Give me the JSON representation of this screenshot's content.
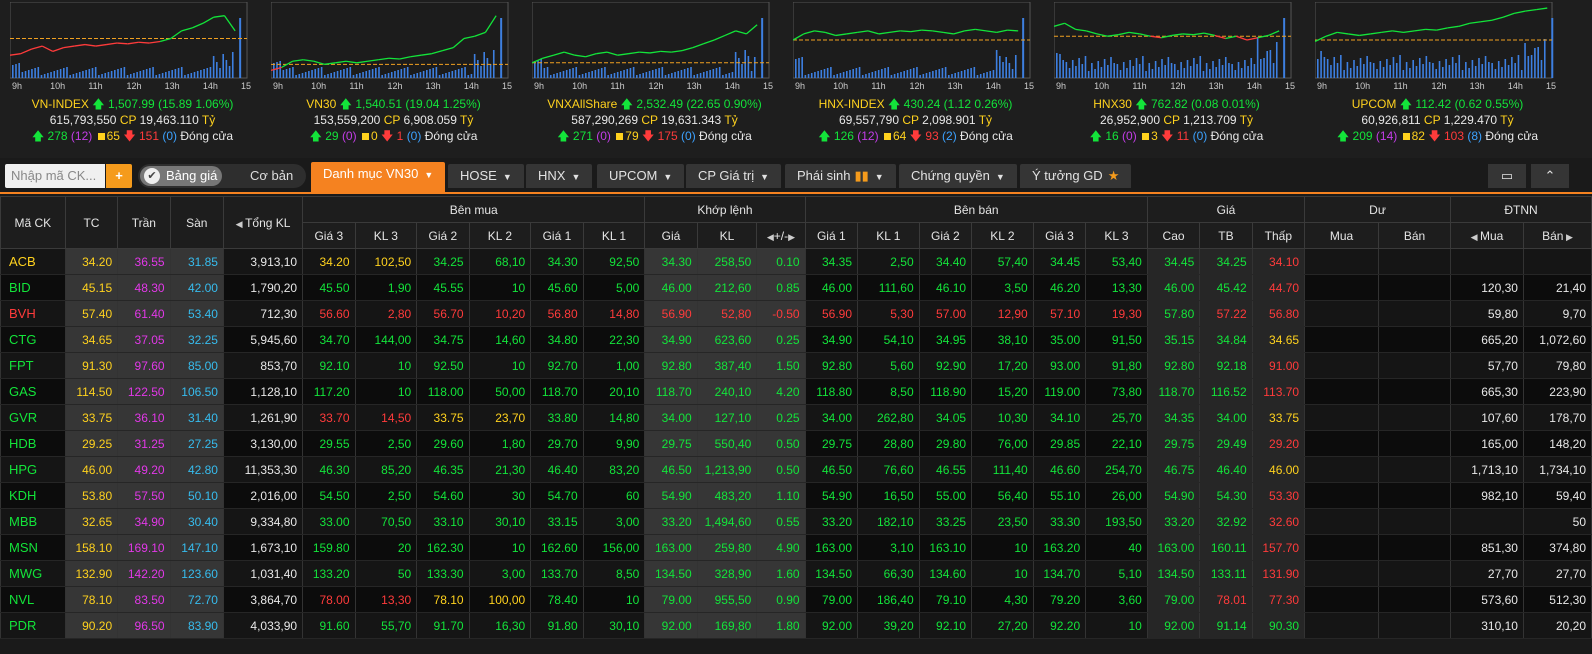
{
  "times": [
    "9h",
    "10h",
    "11h",
    "12h",
    "13h",
    "14h",
    "15h"
  ],
  "indices": [
    {
      "name": "VN-INDEX",
      "value": "1,507.99",
      "change": "15.89",
      "pct": "1.06%",
      "dir": "up",
      "volume": "615,793,550",
      "cp": "CP",
      "val": "19,463.110",
      "unit": "Tỷ",
      "advances": "278",
      "ceilings": "12",
      "unchanged": "65",
      "declines": "151",
      "floors": "0",
      "status": "Đóng cửa",
      "line": [
        0.3,
        0.32,
        0.38,
        0.42,
        0.35,
        0.4,
        0.42,
        0.44,
        0.42,
        0.44,
        0.46,
        0.45,
        0.47,
        0.46,
        0.48,
        0.52,
        0.62,
        0.66,
        0.72,
        0.8,
        0.82,
        0.62
      ],
      "refy": 0.52,
      "tradeend": 0.95
    },
    {
      "name": "VN30",
      "value": "1,540.51",
      "change": "19.04",
      "pct": "1.25%",
      "dir": "up",
      "volume": "153,559,200",
      "cp": "CP",
      "val": "6,908.059",
      "unit": "Tỷ",
      "advances": "29",
      "ceilings": "0",
      "unchanged": "0",
      "declines": "1",
      "floors": "0",
      "status": "Đóng cửa",
      "line": [
        0.1,
        0.14,
        0.22,
        0.24,
        0.22,
        0.18,
        0.2,
        0.22,
        0.2,
        0.22,
        0.24,
        0.26,
        0.25,
        0.28,
        0.3,
        0.32,
        0.36,
        0.4,
        0.52,
        0.55,
        0.6,
        0.82
      ],
      "refy": 0.18,
      "tradeend": 0.95
    },
    {
      "name": "VNXAllShare",
      "value": "2,532.49",
      "change": "22.65",
      "pct": "0.90%",
      "dir": "up",
      "volume": "587,290,269",
      "cp": "CP",
      "val": "19,631.343",
      "unit": "Tỷ",
      "advances": "271",
      "ceilings": "0",
      "unchanged": "79",
      "declines": "175",
      "floors": "0",
      "status": "Đóng cửa",
      "line": [
        0.2,
        0.26,
        0.3,
        0.34,
        0.3,
        0.28,
        0.32,
        0.34,
        0.3,
        0.32,
        0.34,
        0.33,
        0.35,
        0.34,
        0.36,
        0.4,
        0.45,
        0.5,
        0.56,
        0.62,
        0.58,
        0.7
      ],
      "refy": 0.2,
      "tradeend": 0.95
    },
    {
      "name": "HNX-INDEX",
      "value": "430.24",
      "change": "1.12",
      "pct": "0.26%",
      "dir": "up",
      "volume": "69,557,790",
      "cp": "CP",
      "val": "2,098.901",
      "unit": "Tỷ",
      "advances": "126",
      "ceilings": "12",
      "unchanged": "64",
      "declines": "93",
      "floors": "2",
      "status": "Đóng cửa",
      "line": [
        0.5,
        0.58,
        0.62,
        0.6,
        0.56,
        0.58,
        0.6,
        0.62,
        0.58,
        0.6,
        0.62,
        0.61,
        0.63,
        0.62,
        0.6,
        0.58,
        0.62,
        0.64,
        0.62,
        0.6,
        0.63,
        0.62
      ],
      "refy": 0.5,
      "tradeend": 0.95
    },
    {
      "name": "HNX30",
      "value": "762.82",
      "change": "0.08",
      "pct": "0.01%",
      "dir": "up",
      "volume": "26,952,900",
      "cp": "CP",
      "val": "1,213.709",
      "unit": "Tỷ",
      "advances": "16",
      "ceilings": "0",
      "unchanged": "3",
      "declines": "11",
      "floors": "0",
      "status": "Đóng cửa",
      "line": [
        0.68,
        0.72,
        0.64,
        0.62,
        0.58,
        0.55,
        0.57,
        0.6,
        0.58,
        0.55,
        0.53,
        0.56,
        0.58,
        0.57,
        0.59,
        0.56,
        0.52,
        0.55,
        0.5,
        0.53,
        0.56,
        0.62
      ],
      "refy": 0.55,
      "tradeend": 0.95
    },
    {
      "name": "UPCOM",
      "value": "112.42",
      "change": "0.62",
      "pct": "0.55%",
      "dir": "up",
      "volume": "60,926,811",
      "cp": "CP",
      "val": "1,229.470",
      "unit": "Tỷ",
      "advances": "209",
      "ceilings": "14",
      "unchanged": "82",
      "declines": "103",
      "floors": "8",
      "status": "Đóng cửa",
      "line": [
        0.48,
        0.55,
        0.6,
        0.58,
        0.56,
        0.58,
        0.6,
        0.62,
        0.6,
        0.62,
        0.64,
        0.63,
        0.66,
        0.68,
        0.72,
        0.74,
        0.76,
        0.8,
        0.85,
        0.88,
        0.9,
        0.92
      ],
      "refy": 0.5,
      "tradeend": 0.98
    }
  ],
  "toolbar": {
    "search_placeholder": "Nhập mã CK...",
    "add_label": "+",
    "toggle_on": "Bảng giá",
    "toggle_off": "Cơ bản",
    "tabs": [
      "Danh mục VN30",
      "HOSE",
      "HNX",
      "UPCOM",
      "CP Giá trị",
      "Phái sinh",
      "Chứng quyền",
      "Ý tưởng GD"
    ]
  },
  "headers": {
    "symbol": "Mã CK",
    "ref": "TC",
    "ceil": "Trần",
    "floor": "Sàn",
    "total": "Tổng KL",
    "buy": "Bên mua",
    "matched": "Khớp lệnh",
    "sell": "Bên bán",
    "price": "Giá",
    "remaining": "Dư",
    "foreign": "ĐTNN",
    "gia3": "Giá 3",
    "kl3": "KL 3",
    "gia2": "Giá 2",
    "kl2": "KL 2",
    "gia1": "Giá 1",
    "kl1": "KL 1",
    "gia": "Giá",
    "kl": "KL",
    "chg": "+/-",
    "cao": "Cao",
    "tb": "TB",
    "thap": "Thấp",
    "mua": "Mua",
    "ban": "Bán"
  },
  "colors": {
    "up": "#13e43a",
    "down": "#ff3b3b",
    "ref": "#ffd21e",
    "ceil": "#e238e8",
    "floor": "#36bcee",
    "accent": "#f58220"
  },
  "rows": [
    {
      "sym": "ACB",
      "c": "r",
      "tc": "34.20",
      "tran": "36.55",
      "san": "31.85",
      "tkl": "3,913,10",
      "b": [
        "34.20",
        "102,50",
        "34.25",
        "68,10",
        "34.30",
        "92,50"
      ],
      "bc": [
        "r",
        "r",
        "g",
        "g",
        "g",
        "g"
      ],
      "m": [
        "34.30",
        "258,50",
        "0.10"
      ],
      "mc": "g",
      "s": [
        "34.35",
        "2,50",
        "34.40",
        "57,40",
        "34.45",
        "53,40"
      ],
      "sc": [
        "g",
        "g",
        "g",
        "g",
        "g",
        "g"
      ],
      "h": [
        "34.45",
        "34.25",
        "34.10"
      ],
      "hc": [
        "g",
        "g",
        "d"
      ],
      "f": [
        "",
        ""
      ]
    },
    {
      "sym": "BID",
      "c": "g",
      "tc": "45.15",
      "tran": "48.30",
      "san": "42.00",
      "tkl": "1,790,20",
      "b": [
        "45.50",
        "1,90",
        "45.55",
        "10",
        "45.60",
        "5,00"
      ],
      "bc": [
        "g",
        "g",
        "g",
        "g",
        "g",
        "g"
      ],
      "m": [
        "46.00",
        "212,60",
        "0.85"
      ],
      "mc": "g",
      "s": [
        "46.00",
        "111,60",
        "46.10",
        "3,50",
        "46.20",
        "13,30"
      ],
      "sc": [
        "g",
        "g",
        "g",
        "g",
        "g",
        "g"
      ],
      "h": [
        "46.00",
        "45.42",
        "44.70"
      ],
      "hc": [
        "g",
        "g",
        "d"
      ],
      "f": [
        "120,30",
        "21,40"
      ]
    },
    {
      "sym": "BVH",
      "c": "d",
      "tc": "57.40",
      "tran": "61.40",
      "san": "53.40",
      "tkl": "712,30",
      "b": [
        "56.60",
        "2,80",
        "56.70",
        "10,20",
        "56.80",
        "14,80"
      ],
      "bc": [
        "d",
        "d",
        "d",
        "d",
        "d",
        "d"
      ],
      "m": [
        "56.90",
        "52,80",
        "-0.50"
      ],
      "mc": "d",
      "s": [
        "56.90",
        "5,30",
        "57.00",
        "12,90",
        "57.10",
        "19,30"
      ],
      "sc": [
        "d",
        "d",
        "d",
        "d",
        "d",
        "d"
      ],
      "h": [
        "57.80",
        "57.22",
        "56.80"
      ],
      "hc": [
        "g",
        "d",
        "d"
      ],
      "f": [
        "59,80",
        "9,70"
      ]
    },
    {
      "sym": "CTG",
      "c": "g",
      "tc": "34.65",
      "tran": "37.05",
      "san": "32.25",
      "tkl": "5,945,60",
      "b": [
        "34.70",
        "144,00",
        "34.75",
        "14,60",
        "34.80",
        "22,30"
      ],
      "bc": [
        "g",
        "g",
        "g",
        "g",
        "g",
        "g"
      ],
      "m": [
        "34.90",
        "623,60",
        "0.25"
      ],
      "mc": "g",
      "s": [
        "34.90",
        "54,10",
        "34.95",
        "38,10",
        "35.00",
        "91,50"
      ],
      "sc": [
        "g",
        "g",
        "g",
        "g",
        "g",
        "g"
      ],
      "h": [
        "35.15",
        "34.84",
        "34.65"
      ],
      "hc": [
        "g",
        "g",
        "r"
      ],
      "f": [
        "665,20",
        "1,072,60"
      ]
    },
    {
      "sym": "FPT",
      "c": "g",
      "tc": "91.30",
      "tran": "97.60",
      "san": "85.00",
      "tkl": "853,70",
      "b": [
        "92.10",
        "10",
        "92.50",
        "10",
        "92.70",
        "1,00"
      ],
      "bc": [
        "g",
        "g",
        "g",
        "g",
        "g",
        "g"
      ],
      "m": [
        "92.80",
        "387,40",
        "1.50"
      ],
      "mc": "g",
      "s": [
        "92.80",
        "5,60",
        "92.90",
        "17,20",
        "93.00",
        "91,80"
      ],
      "sc": [
        "g",
        "g",
        "g",
        "g",
        "g",
        "g"
      ],
      "h": [
        "92.80",
        "92.18",
        "91.00"
      ],
      "hc": [
        "g",
        "g",
        "d"
      ],
      "f": [
        "57,70",
        "79,80"
      ]
    },
    {
      "sym": "GAS",
      "c": "g",
      "tc": "114.50",
      "tran": "122.50",
      "san": "106.50",
      "tkl": "1,128,10",
      "b": [
        "117.20",
        "10",
        "118.00",
        "50,00",
        "118.70",
        "20,10"
      ],
      "bc": [
        "g",
        "g",
        "g",
        "g",
        "g",
        "g"
      ],
      "m": [
        "118.70",
        "240,10",
        "4.20"
      ],
      "mc": "g",
      "s": [
        "118.80",
        "8,50",
        "118.90",
        "15,20",
        "119.00",
        "73,80"
      ],
      "sc": [
        "g",
        "g",
        "g",
        "g",
        "g",
        "g"
      ],
      "h": [
        "118.70",
        "116.52",
        "113.70"
      ],
      "hc": [
        "g",
        "g",
        "d"
      ],
      "f": [
        "665,30",
        "223,90"
      ]
    },
    {
      "sym": "GVR",
      "c": "g",
      "tc": "33.75",
      "tran": "36.10",
      "san": "31.40",
      "tkl": "1,261,90",
      "b": [
        "33.70",
        "14,50",
        "33.75",
        "23,70",
        "33.80",
        "14,80"
      ],
      "bc": [
        "d",
        "d",
        "r",
        "r",
        "g",
        "g"
      ],
      "m": [
        "34.00",
        "127,10",
        "0.25"
      ],
      "mc": "g",
      "s": [
        "34.00",
        "262,80",
        "34.05",
        "10,30",
        "34.10",
        "25,70"
      ],
      "sc": [
        "g",
        "g",
        "g",
        "g",
        "g",
        "g"
      ],
      "h": [
        "34.35",
        "34.00",
        "33.75"
      ],
      "hc": [
        "g",
        "g",
        "r"
      ],
      "f": [
        "107,60",
        "178,70"
      ]
    },
    {
      "sym": "HDB",
      "c": "g",
      "tc": "29.25",
      "tran": "31.25",
      "san": "27.25",
      "tkl": "3,130,00",
      "b": [
        "29.55",
        "2,50",
        "29.60",
        "1,80",
        "29.70",
        "9,90"
      ],
      "bc": [
        "g",
        "g",
        "g",
        "g",
        "g",
        "g"
      ],
      "m": [
        "29.75",
        "550,40",
        "0.50"
      ],
      "mc": "g",
      "s": [
        "29.75",
        "28,80",
        "29.80",
        "76,00",
        "29.85",
        "22,10"
      ],
      "sc": [
        "g",
        "g",
        "g",
        "g",
        "g",
        "g"
      ],
      "h": [
        "29.75",
        "29.49",
        "29.20"
      ],
      "hc": [
        "g",
        "g",
        "d"
      ],
      "f": [
        "165,00",
        "148,20"
      ]
    },
    {
      "sym": "HPG",
      "c": "g",
      "tc": "46.00",
      "tran": "49.20",
      "san": "42.80",
      "tkl": "11,353,30",
      "b": [
        "46.30",
        "85,20",
        "46.35",
        "21,30",
        "46.40",
        "83,20"
      ],
      "bc": [
        "g",
        "g",
        "g",
        "g",
        "g",
        "g"
      ],
      "m": [
        "46.50",
        "1,213,90",
        "0.50"
      ],
      "mc": "g",
      "s": [
        "46.50",
        "76,60",
        "46.55",
        "111,40",
        "46.60",
        "254,70"
      ],
      "sc": [
        "g",
        "g",
        "g",
        "g",
        "g",
        "g"
      ],
      "h": [
        "46.75",
        "46.40",
        "46.00"
      ],
      "hc": [
        "g",
        "g",
        "r"
      ],
      "f": [
        "1,713,10",
        "1,734,10"
      ]
    },
    {
      "sym": "KDH",
      "c": "g",
      "tc": "53.80",
      "tran": "57.50",
      "san": "50.10",
      "tkl": "2,016,00",
      "b": [
        "54.50",
        "2,50",
        "54.60",
        "30",
        "54.70",
        "60"
      ],
      "bc": [
        "g",
        "g",
        "g",
        "g",
        "g",
        "g"
      ],
      "m": [
        "54.90",
        "483,20",
        "1.10"
      ],
      "mc": "g",
      "s": [
        "54.90",
        "16,50",
        "55.00",
        "56,40",
        "55.10",
        "26,00"
      ],
      "sc": [
        "g",
        "g",
        "g",
        "g",
        "g",
        "g"
      ],
      "h": [
        "54.90",
        "54.30",
        "53.30"
      ],
      "hc": [
        "g",
        "g",
        "d"
      ],
      "f": [
        "982,10",
        "59,40"
      ]
    },
    {
      "sym": "MBB",
      "c": "g",
      "tc": "32.65",
      "tran": "34.90",
      "san": "30.40",
      "tkl": "9,334,80",
      "b": [
        "33.00",
        "70,50",
        "33.10",
        "30,10",
        "33.15",
        "3,00"
      ],
      "bc": [
        "g",
        "g",
        "g",
        "g",
        "g",
        "g"
      ],
      "m": [
        "33.20",
        "1,494,60",
        "0.55"
      ],
      "mc": "g",
      "s": [
        "33.20",
        "182,10",
        "33.25",
        "23,50",
        "33.30",
        "193,50"
      ],
      "sc": [
        "g",
        "g",
        "g",
        "g",
        "g",
        "g"
      ],
      "h": [
        "33.20",
        "32.92",
        "32.60"
      ],
      "hc": [
        "g",
        "g",
        "d"
      ],
      "f": [
        "",
        "50"
      ]
    },
    {
      "sym": "MSN",
      "c": "g",
      "tc": "158.10",
      "tran": "169.10",
      "san": "147.10",
      "tkl": "1,673,10",
      "b": [
        "159.80",
        "20",
        "162.30",
        "10",
        "162.60",
        "156,00"
      ],
      "bc": [
        "g",
        "g",
        "g",
        "g",
        "g",
        "g"
      ],
      "m": [
        "163.00",
        "259,80",
        "4.90"
      ],
      "mc": "g",
      "s": [
        "163.00",
        "3,10",
        "163.10",
        "10",
        "163.20",
        "40"
      ],
      "sc": [
        "g",
        "g",
        "g",
        "g",
        "g",
        "g"
      ],
      "h": [
        "163.00",
        "160.11",
        "157.70"
      ],
      "hc": [
        "g",
        "g",
        "d"
      ],
      "f": [
        "851,30",
        "374,80"
      ]
    },
    {
      "sym": "MWG",
      "c": "g",
      "tc": "132.90",
      "tran": "142.20",
      "san": "123.60",
      "tkl": "1,031,40",
      "b": [
        "133.20",
        "50",
        "133.30",
        "3,00",
        "133.70",
        "8,50"
      ],
      "bc": [
        "g",
        "g",
        "g",
        "g",
        "g",
        "g"
      ],
      "m": [
        "134.50",
        "328,90",
        "1.60"
      ],
      "mc": "g",
      "s": [
        "134.50",
        "66,30",
        "134.60",
        "10",
        "134.70",
        "5,10"
      ],
      "sc": [
        "g",
        "g",
        "g",
        "g",
        "g",
        "g"
      ],
      "h": [
        "134.50",
        "133.11",
        "131.90"
      ],
      "hc": [
        "g",
        "g",
        "d"
      ],
      "f": [
        "27,70",
        "27,70"
      ]
    },
    {
      "sym": "NVL",
      "c": "g",
      "tc": "78.10",
      "tran": "83.50",
      "san": "72.70",
      "tkl": "3,864,70",
      "b": [
        "78.00",
        "13,30",
        "78.10",
        "100,00",
        "78.40",
        "10"
      ],
      "bc": [
        "d",
        "d",
        "r",
        "r",
        "g",
        "g"
      ],
      "m": [
        "79.00",
        "955,50",
        "0.90"
      ],
      "mc": "g",
      "s": [
        "79.00",
        "186,40",
        "79.10",
        "4,30",
        "79.20",
        "3,60"
      ],
      "sc": [
        "g",
        "g",
        "g",
        "g",
        "g",
        "g"
      ],
      "h": [
        "79.00",
        "78.01",
        "77.30"
      ],
      "hc": [
        "g",
        "d",
        "d"
      ],
      "f": [
        "573,60",
        "512,30"
      ]
    },
    {
      "sym": "PDR",
      "c": "g",
      "tc": "90.20",
      "tran": "96.50",
      "san": "83.90",
      "tkl": "4,033,90",
      "b": [
        "91.60",
        "55,70",
        "91.70",
        "16,30",
        "91.80",
        "30,10"
      ],
      "bc": [
        "g",
        "g",
        "g",
        "g",
        "g",
        "g"
      ],
      "m": [
        "92.00",
        "169,80",
        "1.80"
      ],
      "mc": "g",
      "s": [
        "92.00",
        "39,20",
        "92.10",
        "27,20",
        "92.20",
        "10"
      ],
      "sc": [
        "g",
        "g",
        "g",
        "g",
        "g",
        "g"
      ],
      "h": [
        "92.00",
        "91.14",
        "90.30"
      ],
      "hc": [
        "g",
        "g",
        "g"
      ],
      "f": [
        "310,10",
        "20,20"
      ]
    }
  ]
}
